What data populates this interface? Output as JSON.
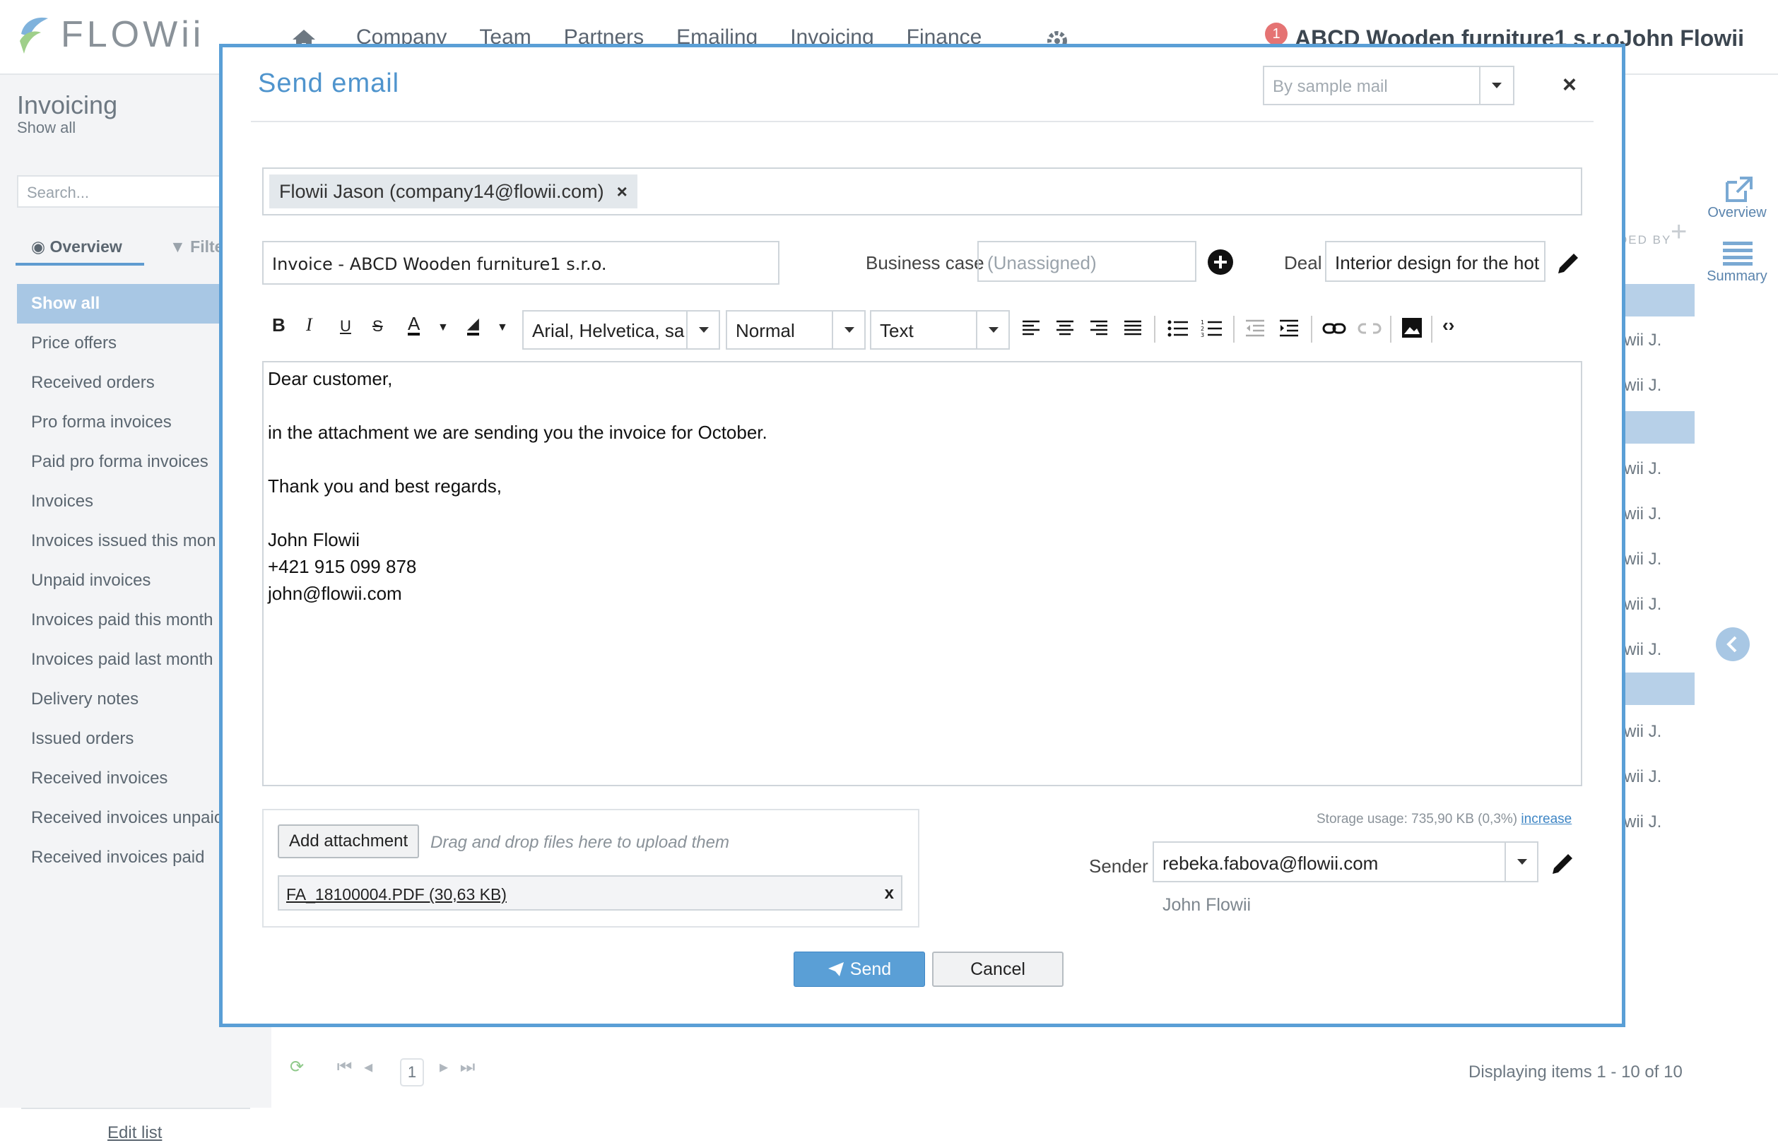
{
  "app": {
    "logo_text": "FLOWii",
    "nav": [
      "Company",
      "Team",
      "Partners",
      "Emailing",
      "Invoicing",
      "Finance"
    ],
    "notification_count": "1",
    "company": "ABCD Wooden furniture1 s.r.o.",
    "user": "John Flowii"
  },
  "sidebar": {
    "title": "Invoicing",
    "subtitle": "Show all",
    "search_placeholder": "Search...",
    "tab_overview": "Overview",
    "tab_filter": "Filte",
    "items": [
      "Show all",
      "Price offers",
      "Received orders",
      "Pro forma invoices",
      "Paid pro forma invoices",
      "Invoices",
      "Invoices issued this mon",
      "Unpaid invoices",
      "Invoices paid this month",
      "Invoices paid last month",
      "Delivery notes",
      "Issued orders",
      "Received invoices",
      "Received invoices unpaic",
      "Received invoices paid"
    ],
    "edit_list": "Edit list"
  },
  "right_rail": {
    "overview": "Overview",
    "summary": "Summary",
    "column_header": "DED BY"
  },
  "list_rows": [
    "wii J.",
    "wii J.",
    "wii J.",
    "wii J.",
    "wii J.",
    "wii J.",
    "wii J.",
    "wii J.",
    "wii J.",
    "wii J."
  ],
  "pager": {
    "page": "1",
    "display": "Displaying items 1 - 10 of 10"
  },
  "modal": {
    "title": "Send email",
    "sample_mail_placeholder": "By sample mail",
    "recipient": "Flowii Jason (company14@flowii.com)",
    "subject": "Invoice - ABCD Wooden furniture1 s.r.o.",
    "business_case_label": "Business case",
    "business_case_placeholder": "(Unassigned)",
    "deal_label": "Deal",
    "deal_value": "Interior design for the hot",
    "toolbar": {
      "font": "Arial, Helvetica, sa",
      "size": "Normal",
      "format": "Text"
    },
    "body": {
      "greeting": "Dear customer,",
      "line1": "in the attachment we are sending you the invoice for October.",
      "line2": "Thank you and best regards,",
      "sig_name": "John Flowii",
      "sig_phone": "+421 915 099 878",
      "sig_email": "john@flowii.com"
    },
    "attachment_button": "Add attachment",
    "drop_hint": "Drag and drop files here to upload them",
    "attachment_file": "FA_18100004.PDF (30,63 KB)",
    "storage_text": "Storage usage: 735,90 KB (0,3%)",
    "storage_link": "increase",
    "sender_label": "Sender",
    "sender_email": "rebeka.fabova@flowii.com",
    "sender_name": "John Flowii",
    "send_label": "Send",
    "cancel_label": "Cancel",
    "accent_color": "#5a9fd6"
  }
}
